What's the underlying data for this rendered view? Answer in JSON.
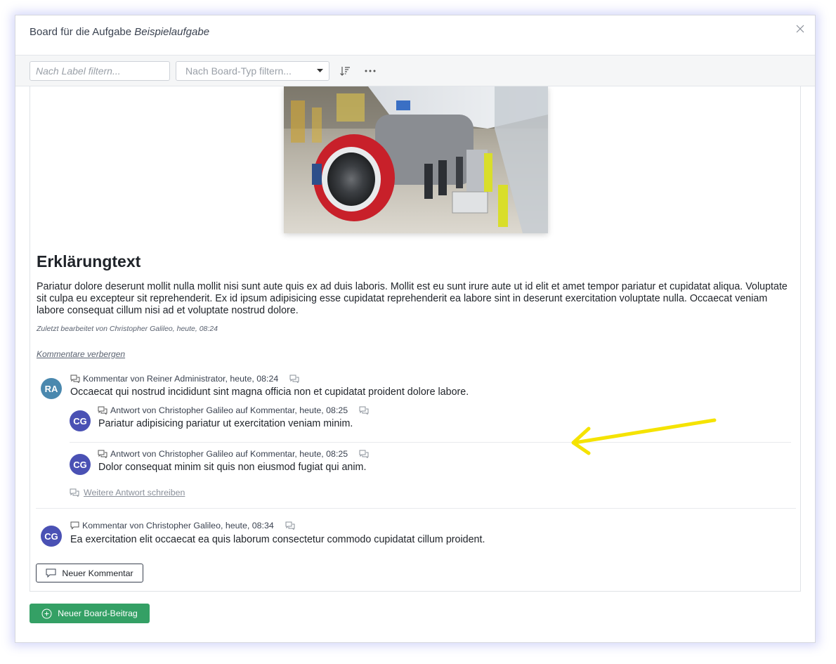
{
  "modal": {
    "title_prefix": "Board für die Aufgabe",
    "title_task": "Beispielaufgabe"
  },
  "toolbar": {
    "label_filter_placeholder": "Nach Label filtern...",
    "board_type_placeholder": "Nach Board-Typ filtern..."
  },
  "entry": {
    "title": "Erklärungtext",
    "body": "Pariatur dolore deserunt mollit nulla mollit nisi sunt aute quis ex ad duis laboris. Mollit est eu sunt irure aute ut id elit et amet tempor pariatur et cupidatat aliqua. Voluptate sit culpa eu excepteur sit reprehenderit. Ex id ipsum adipisicing esse cupidatat reprehenderit ea labore sint in deserunt exercitation voluptate nulla. Occaecat veniam labore consequat cillum nisi ad et voluptate nostrud dolore.",
    "edited_info": "Zuletzt bearbeitet von Christopher Galileo, heute, 08:24",
    "hide_comments": "Kommentare verbergen"
  },
  "comments": [
    {
      "initials": "RA",
      "meta": "Kommentar von Reiner Administrator, heute, 08:24",
      "text": "Occaecat qui nostrud incididunt sint magna officia non et cupidatat proident dolore labore.",
      "replies": [
        {
          "initials": "CG",
          "meta": "Antwort von Christopher Galileo auf Kommentar, heute, 08:25",
          "text": "Pariatur adipisicing pariatur ut exercitation veniam minim."
        },
        {
          "initials": "CG",
          "meta": "Antwort von Christopher Galileo auf Kommentar, heute, 08:25",
          "text": "Dolor consequat minim sit quis non eiusmod fugiat qui anim."
        }
      ],
      "more_reply": "Weitere Antwort schreiben"
    },
    {
      "initials": "CG",
      "meta": "Kommentar von Christopher Galileo, heute, 08:34",
      "text": "Ea exercitation elit occaecat ea quis laborum consectetur commodo cupidatat cillum proident."
    }
  ],
  "buttons": {
    "new_comment": "Neuer Kommentar",
    "new_post": "Neuer Board-Beitrag"
  },
  "colors": {
    "accent_green": "#34a065",
    "avatar_ra": "#4a88ae",
    "avatar_cg": "#4a51b4",
    "annotation_arrow": "#f5e300",
    "engine_red": "#c8202a"
  }
}
